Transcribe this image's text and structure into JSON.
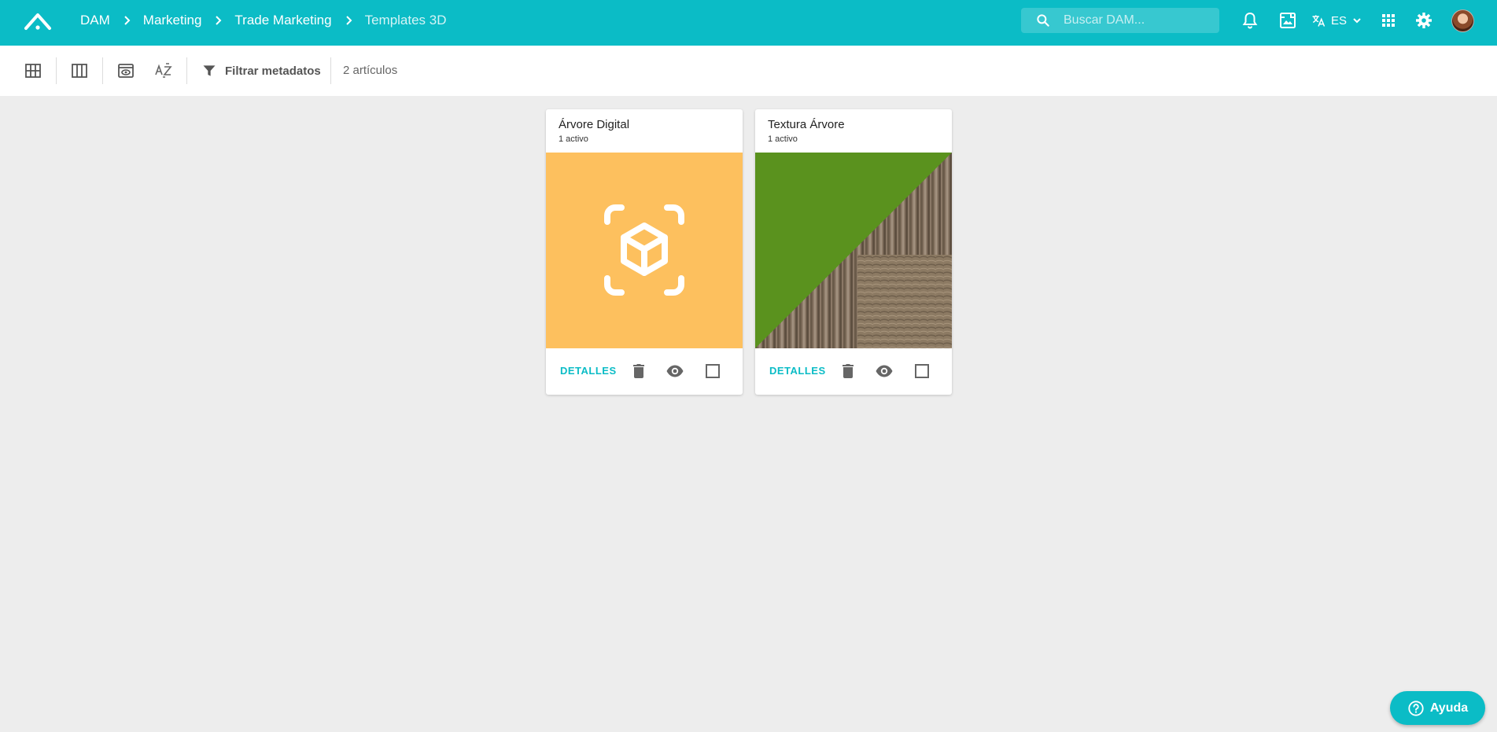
{
  "header": {
    "breadcrumbs": [
      "DAM",
      "Marketing",
      "Trade Marketing",
      "Templates 3D"
    ],
    "search_placeholder": "Buscar DAM...",
    "language": "ES",
    "accent_color": "#0bbcc6"
  },
  "toolbar": {
    "filter_label": "Filtrar metadatos",
    "item_count": "2 artículos",
    "icons": [
      "grid-view-icon",
      "column-view-icon",
      "preview-icon",
      "sort-az-icon",
      "filter-icon"
    ]
  },
  "cards": [
    {
      "title": "Árvore Digital",
      "subtitle": "1 activo",
      "details_label": "DETALLES",
      "thumbnail": "3d-model-icon",
      "thumbnail_color": "#fdc05e"
    },
    {
      "title": "Textura Árvore",
      "subtitle": "1 activo",
      "details_label": "DETALLES",
      "thumbnail": "wood-texture-image",
      "thumbnail_color": "#5a921e"
    }
  ],
  "help": {
    "label": "Ayuda"
  }
}
